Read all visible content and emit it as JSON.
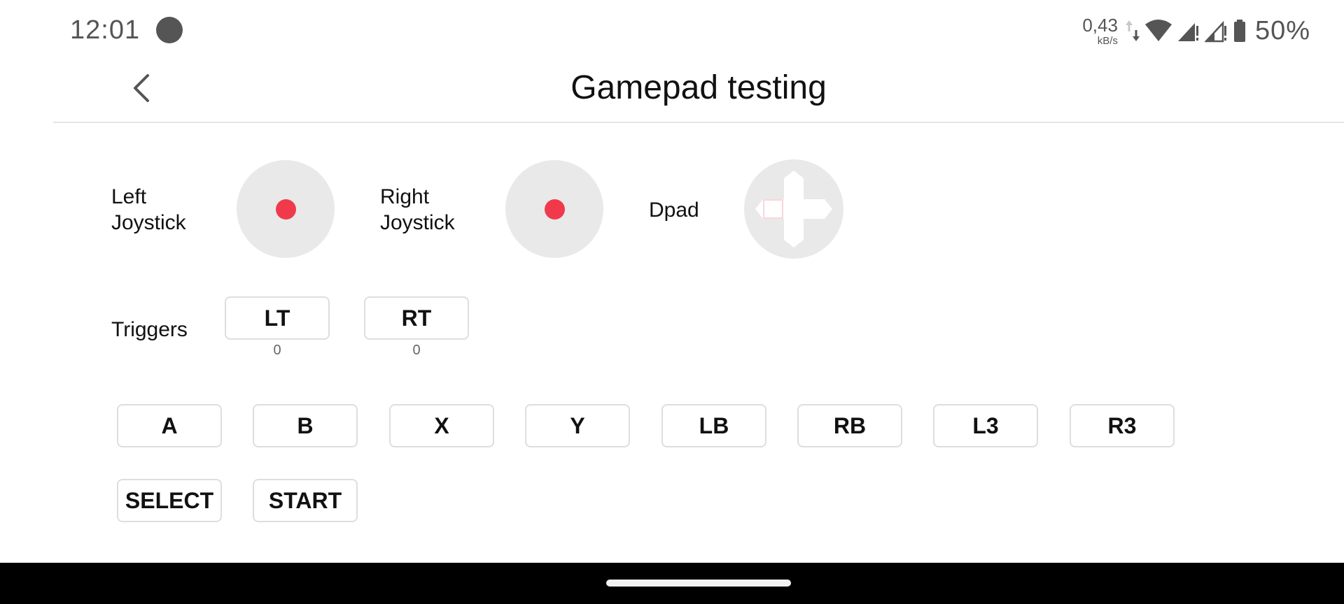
{
  "status_bar": {
    "time": "12:01",
    "net_speed_value": "0,43",
    "net_speed_unit": "kB/s",
    "battery_percent": "50%"
  },
  "header": {
    "title": "Gamepad testing"
  },
  "sticks": {
    "left_label_line1": "Left",
    "left_label_line2": "Joystick",
    "right_label_line1": "Right",
    "right_label_line2": "Joystick",
    "dpad_label": "Dpad"
  },
  "triggers": {
    "label": "Triggers",
    "lt_label": "LT",
    "lt_value": "0",
    "rt_label": "RT",
    "rt_value": "0"
  },
  "buttons": [
    "A",
    "B",
    "X",
    "Y",
    "LB",
    "RB",
    "L3",
    "R3"
  ],
  "system_buttons": [
    "SELECT",
    "START"
  ],
  "colors": {
    "knob": "#f03a4c",
    "stick_bg": "#e9e9e9",
    "border": "#dedede"
  }
}
